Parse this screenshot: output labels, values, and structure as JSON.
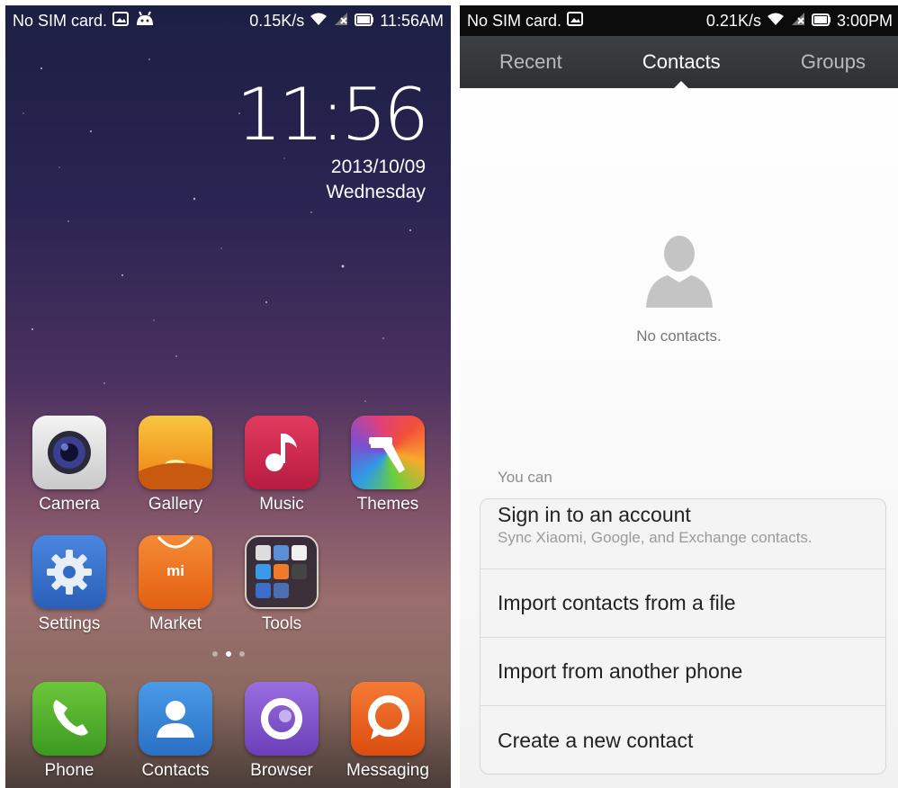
{
  "left": {
    "status": {
      "carrier": "No SIM card.",
      "speed": "0.15K/s",
      "time": "11:56AM",
      "icons": [
        "image-icon",
        "android-icon",
        "wifi-icon",
        "signal-icon",
        "battery-icon"
      ]
    },
    "clock": {
      "time": "11:56",
      "date": "2013/10/09",
      "day": "Wednesday"
    },
    "apps": [
      {
        "label": "Camera",
        "icon": "camera-icon"
      },
      {
        "label": "Gallery",
        "icon": "gallery-icon"
      },
      {
        "label": "Music",
        "icon": "music-icon"
      },
      {
        "label": "Themes",
        "icon": "themes-icon"
      },
      {
        "label": "Settings",
        "icon": "gear-icon"
      },
      {
        "label": "Market",
        "icon": "market-icon",
        "badge": "mi"
      },
      {
        "label": "Tools",
        "icon": "folder-icon"
      }
    ],
    "page_indicator": {
      "count": 3,
      "active": 2
    },
    "dock": [
      {
        "label": "Phone",
        "icon": "phone-icon"
      },
      {
        "label": "Contacts",
        "icon": "contacts-icon"
      },
      {
        "label": "Browser",
        "icon": "browser-icon"
      },
      {
        "label": "Messaging",
        "icon": "messaging-icon"
      }
    ]
  },
  "right": {
    "status": {
      "carrier": "No SIM card.",
      "speed": "0.21K/s",
      "time": "3:00PM"
    },
    "tabs": [
      {
        "label": "Recent",
        "active": false
      },
      {
        "label": "Contacts",
        "active": true
      },
      {
        "label": "Groups",
        "active": false
      }
    ],
    "empty": {
      "text": "No contacts."
    },
    "you_can": "You can",
    "options": [
      {
        "title": "Sign in to an account",
        "subtitle": "Sync Xiaomi, Google, and Exchange contacts."
      },
      {
        "title": "Import contacts from a file"
      },
      {
        "title": "Import from another phone"
      },
      {
        "title": "Create a new contact"
      }
    ]
  },
  "colors": {
    "tab_bar": "#34373a",
    "camera": "#dcdcdc",
    "gallery": "#f0a02a",
    "music": "#c8234a",
    "settings": "#2f6bc6",
    "market": "#ef6b1c",
    "phone": "#4caa2a",
    "contacts": "#2f7fd4",
    "browser": "#7a4fc4",
    "messaging": "#e85a1a"
  }
}
